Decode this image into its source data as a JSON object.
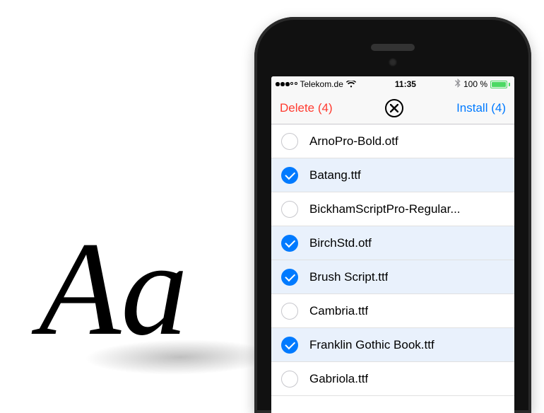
{
  "decor": {
    "aa_text": "Aa"
  },
  "status_bar": {
    "carrier": "Telekom.de",
    "time": "11:35",
    "battery_percent": "100 %"
  },
  "nav": {
    "delete_label": "Delete (4)",
    "install_label": "Install (4)"
  },
  "fonts": [
    {
      "name": "ArnoPro-Bold.otf",
      "selected": false
    },
    {
      "name": "Batang.ttf",
      "selected": true
    },
    {
      "name": "BickhamScriptPro-Regular...",
      "selected": false
    },
    {
      "name": "BirchStd.otf",
      "selected": true
    },
    {
      "name": "Brush Script.ttf",
      "selected": true
    },
    {
      "name": "Cambria.ttf",
      "selected": false
    },
    {
      "name": "Franklin Gothic Book.ttf",
      "selected": true
    },
    {
      "name": "Gabriola.ttf",
      "selected": false
    }
  ],
  "colors": {
    "ios_blue": "#007aff",
    "ios_red": "#ff3b30",
    "battery_green": "#4cd964",
    "selected_row": "#e9f1fc"
  }
}
